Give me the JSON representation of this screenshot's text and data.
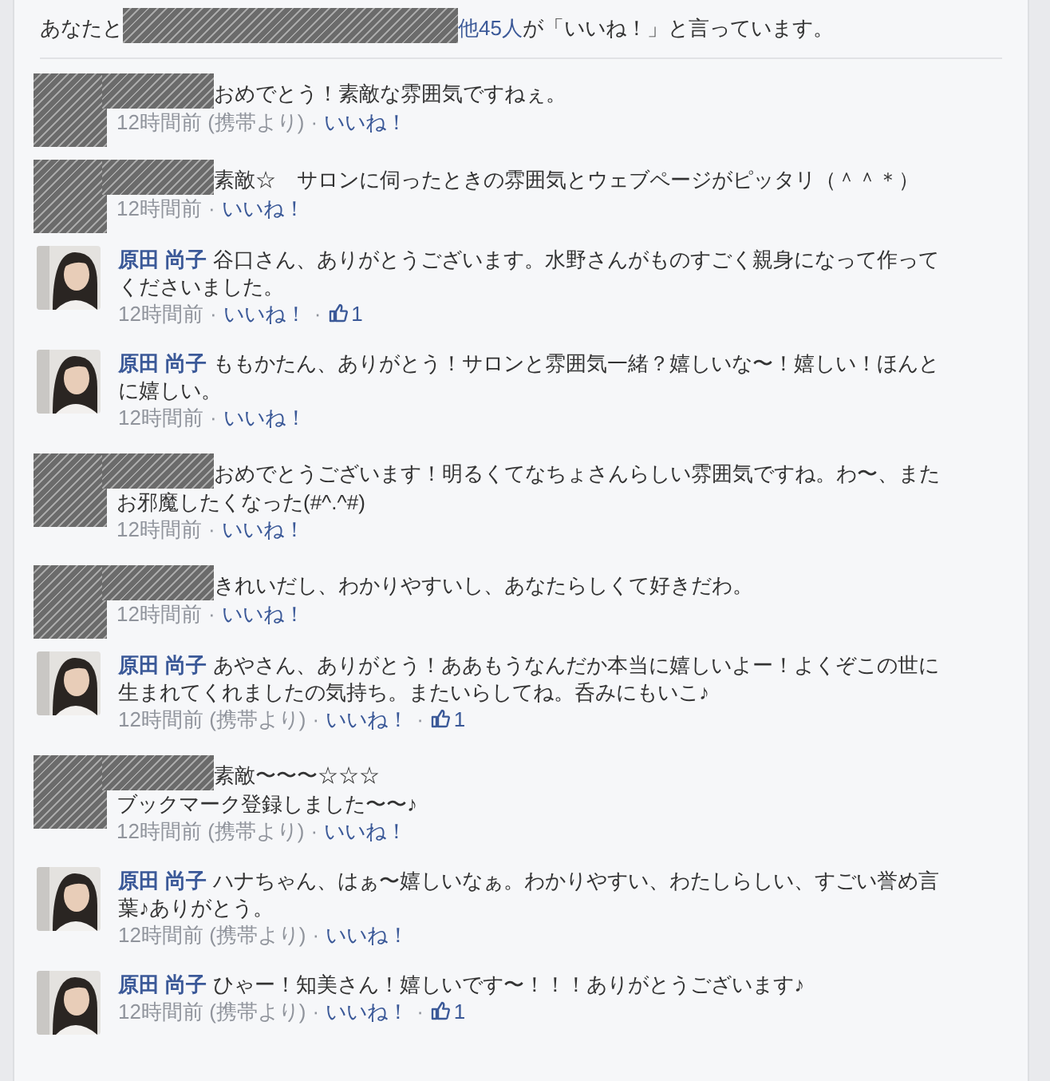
{
  "likes_summary": {
    "prefix": "あなたと",
    "others_link": "他45人",
    "suffix": "が「いいね！」と言っています。"
  },
  "separator": "·",
  "comments": [
    {
      "kind": "redacted",
      "text": "おめでとう！素敵な雰囲気ですねぇ。",
      "time": "12時間前 (携帯より)",
      "like_link": "いいね！"
    },
    {
      "kind": "redacted",
      "text": "素敵☆　サロンに伺ったときの雰囲気とウェブページがピッタリ（＾＾＊）",
      "time": "12時間前",
      "like_link": "いいね！"
    },
    {
      "kind": "named",
      "author": "原田 尚子",
      "text": "谷口さん、ありがとうございます。水野さんがものすごく親身になって作ってくださいました。",
      "time": "12時間前",
      "like_link": "いいね！",
      "like_count": "1"
    },
    {
      "kind": "named",
      "author": "原田 尚子",
      "text": "ももかたん、ありがとう！サロンと雰囲気一緒？嬉しいな〜！嬉しい！ほんとに嬉しい。",
      "time": "12時間前",
      "like_link": "いいね！"
    },
    {
      "kind": "redacted",
      "text": "おめでとうございます！明るくてなちょさんらしい雰囲気ですね。わ〜、またお邪魔したくなった(#^.^#)",
      "time": "12時間前",
      "like_link": "いいね！"
    },
    {
      "kind": "redacted",
      "text": "きれいだし、わかりやすいし、あなたらしくて好きだわ。",
      "time": "12時間前",
      "like_link": "いいね！"
    },
    {
      "kind": "named",
      "author": "原田 尚子",
      "text": "あやさん、ありがとう！ああもうなんだか本当に嬉しいよー！よくぞこの世に生まれてくれましたの気持ち。またいらしてね。呑みにもいこ♪",
      "time": "12時間前 (携帯より)",
      "like_link": "いいね！",
      "like_count": "1"
    },
    {
      "kind": "redacted",
      "text": "素敵〜〜〜☆☆☆\nブックマーク登録しました〜〜♪",
      "time": "12時間前 (携帯より)",
      "like_link": "いいね！"
    },
    {
      "kind": "named",
      "author": "原田 尚子",
      "text": "ハナちゃん、はぁ〜嬉しいなぁ。わかりやすい、わたしらしい、すごい誉め言葉♪ありがとう。",
      "time": "12時間前 (携帯より)",
      "like_link": "いいね！"
    },
    {
      "kind": "named",
      "author": "原田 尚子",
      "text": "ひゃー！知美さん！嬉しいです〜！！！ありがとうございます♪",
      "time": "12時間前 (携帯より)",
      "like_link": "いいね！",
      "like_count": "1"
    }
  ]
}
